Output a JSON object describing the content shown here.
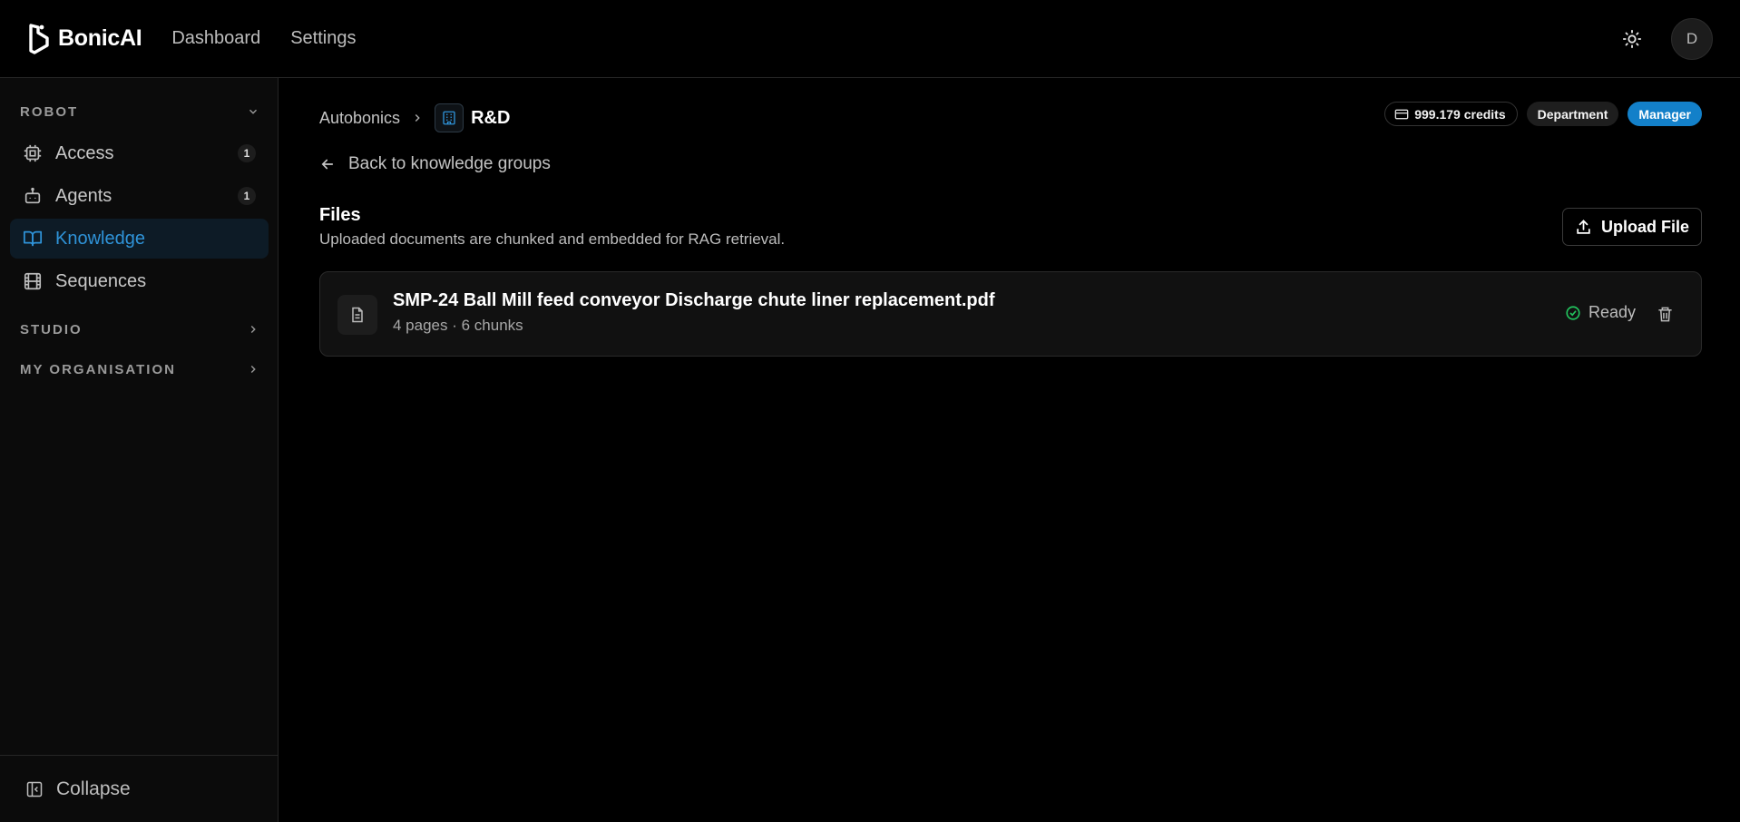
{
  "app": {
    "brand": "BonicAI",
    "nav": [
      "Dashboard",
      "Settings"
    ],
    "user_initial": "D",
    "accent_color": "#1380c9"
  },
  "sidebar": {
    "sections": [
      {
        "title": "ROBOT",
        "expanded": true,
        "items": [
          {
            "label": "Access",
            "count": "1",
            "icon": "cpu-icon"
          },
          {
            "label": "Agents",
            "count": "1",
            "icon": "robot-icon"
          },
          {
            "label": "Knowledge",
            "icon": "book-open-icon",
            "active": true
          },
          {
            "label": "Sequences",
            "icon": "film-icon"
          }
        ]
      },
      {
        "title": "STUDIO",
        "expanded": false
      },
      {
        "title": "MY ORGANISATION",
        "expanded": false
      }
    ],
    "collapse_label": "Collapse"
  },
  "header": {
    "breadcrumb_root": "Autobonics",
    "breadcrumb_current": "R&D",
    "credits": "999.179 credits",
    "tag_department": "Department",
    "tag_role": "Manager"
  },
  "main": {
    "back_label": "Back to knowledge groups",
    "files_title": "Files",
    "files_subtitle": "Uploaded documents are chunked and embedded for RAG retrieval.",
    "upload_label": "Upload File",
    "files": [
      {
        "name": "SMP-24 Ball Mill feed conveyor Discharge chute liner replacement.pdf",
        "meta": "4 pages · 6 chunks",
        "status": "Ready",
        "status_color": "#22c55e"
      }
    ]
  }
}
